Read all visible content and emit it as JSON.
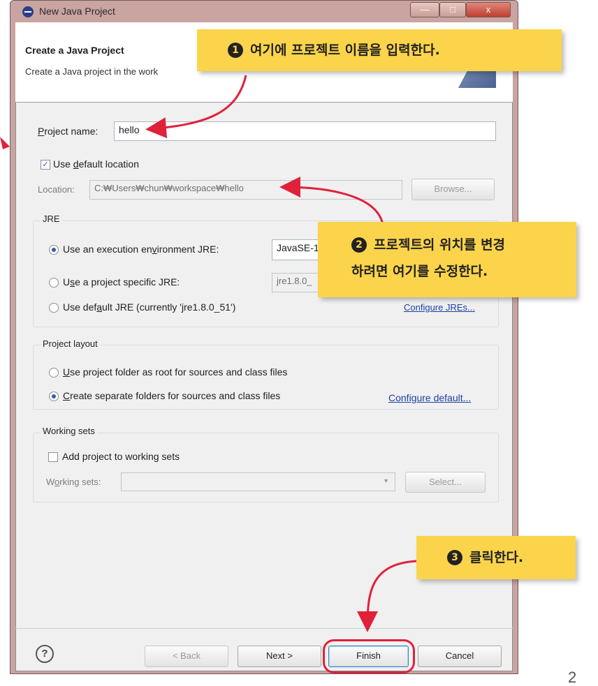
{
  "window": {
    "title": "New Java Project",
    "controls": {
      "minimize": "—",
      "maximize": "□",
      "close": "x"
    }
  },
  "banner": {
    "title": "Create a Java Project",
    "subtitle": "Create a Java project in the work"
  },
  "project": {
    "name_label": "roject name:",
    "name_label_mnemonic": "P",
    "name_value": "hello",
    "default_location_label_pre": "Use ",
    "default_location_mnemonic": "d",
    "default_location_label_post": "efault location",
    "default_location_checked": true,
    "location_label": "Location:",
    "location_value": "C:₩Users₩chun₩workspace₩hello",
    "browse_label": "Browse..."
  },
  "jre": {
    "group_title": "JRE",
    "option_env_pre": "Use an execution en",
    "option_env_mnemonic": "v",
    "option_env_post": "ironment JRE:",
    "option_env_selected": true,
    "env_value": "JavaSE-1",
    "option_specific_pre": "U",
    "option_specific_mnemonic": "s",
    "option_specific_post": "e a project specific JRE:",
    "specific_value": "jre1.8.0_",
    "option_default_pre": "Use def",
    "option_default_mnemonic": "a",
    "option_default_post": "ult JRE (currently 'jre1.8.0_51')",
    "configure_link": "Configure JREs..."
  },
  "layout": {
    "group_title": "Project layout",
    "option_root_mnemonic": "U",
    "option_root_post": "se project folder as root for sources and class files",
    "option_separate_mnemonic": "C",
    "option_separate_post": "reate separate folders for sources and class files",
    "option_separate_selected": true,
    "configure_link": "Configure default..."
  },
  "working_sets": {
    "group_title": "Working sets",
    "add_label": "Add project to working sets",
    "add_checked": false,
    "sets_label_pre": "W",
    "sets_label_mnemonic": "o",
    "sets_label_post": "rking sets:",
    "sets_value": "",
    "select_label": "Select..."
  },
  "footer": {
    "help": "?",
    "back": "< Back",
    "next": "Next >",
    "finish": "Finish",
    "cancel": "Cancel"
  },
  "annotations": [
    {
      "number": "1",
      "text": "여기에 프로젝트 이름을 입력한다."
    },
    {
      "number": "2",
      "line1": "프로젝트의 위치를 변경",
      "line2": "하려면 여기를 수정한다."
    },
    {
      "number": "3",
      "text": "클릭한다."
    }
  ],
  "page_number": "2",
  "colors": {
    "callout": "#fbd44b",
    "arrow": "#e0213a",
    "frame": "#c9a4a1",
    "accent": "#2f5fa8"
  }
}
